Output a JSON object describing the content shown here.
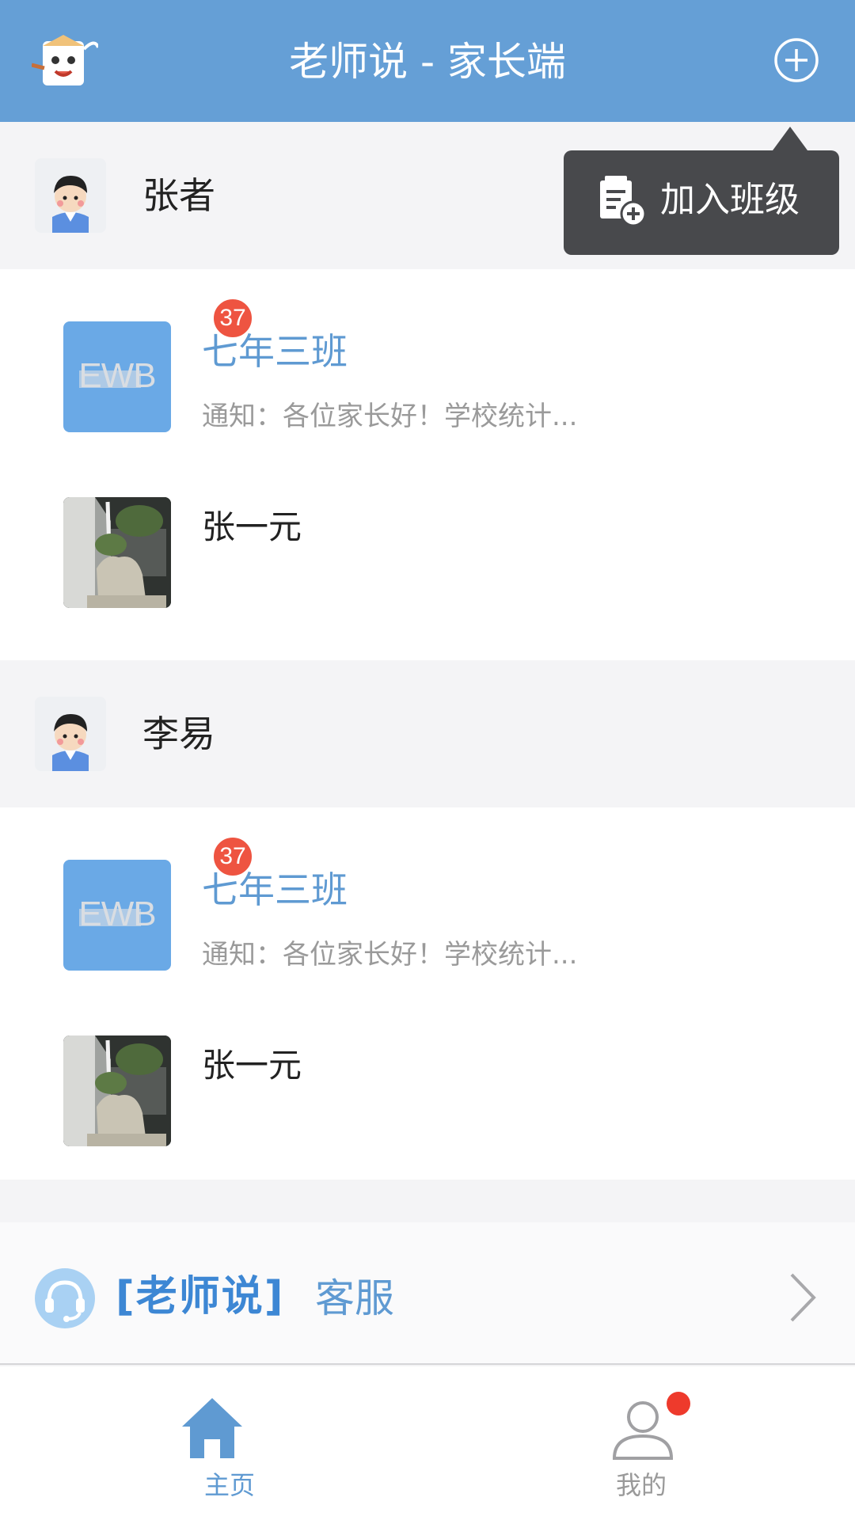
{
  "header": {
    "title": "老师说 - 家长端",
    "logo_icon": "mascot-logo-icon",
    "add_icon": "plus-circle-icon",
    "bg_color": "#659fd6"
  },
  "popover": {
    "label": "加入班级",
    "icon": "join-class-icon"
  },
  "students": [
    {
      "name": "张者",
      "avatar_icon": "student-avatar-icon",
      "class": {
        "name": "七年三班",
        "thumb_text": "EWB",
        "badge": "37",
        "notice": "通知：各位家长好！学校统计..."
      },
      "child": {
        "name": "张一元"
      }
    },
    {
      "name": "李易",
      "avatar_icon": "student-avatar-icon",
      "class": {
        "name": "七年三班",
        "thumb_text": "EWB",
        "badge": "37",
        "notice": "通知：各位家长好！学校统计..."
      },
      "child": {
        "name": "张一元"
      }
    }
  ],
  "service": {
    "brand": "[老师说]",
    "suffix": "客服",
    "icon": "headset-icon",
    "chevron_icon": "chevron-right-icon"
  },
  "tabbar": {
    "home": {
      "label": "主页",
      "icon": "home-icon",
      "active_color": "#5f9ad2"
    },
    "mine": {
      "label": "我的",
      "icon": "user-icon",
      "inactive_color": "#9a9a9a",
      "has_dot": true
    }
  }
}
